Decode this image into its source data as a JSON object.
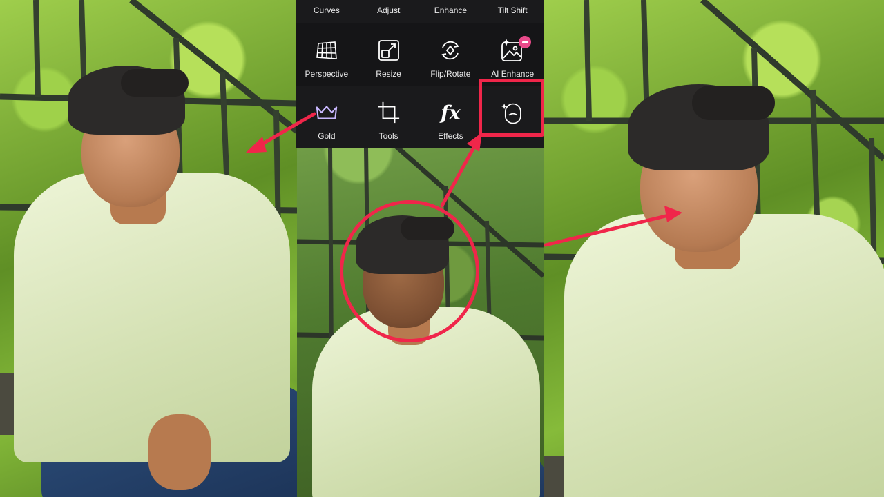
{
  "app": {
    "menu": {
      "row_top": [
        {
          "label": "Curves"
        },
        {
          "label": "Adjust"
        },
        {
          "label": "Enhance"
        },
        {
          "label": "Tilt Shift"
        }
      ],
      "row_mid": [
        {
          "label": "Perspective",
          "icon": "perspective-grid-icon"
        },
        {
          "label": "Resize",
          "icon": "resize-icon"
        },
        {
          "label": "Flip/Rotate",
          "icon": "flip-rotate-icon"
        },
        {
          "label": "AI Enhance",
          "icon": "ai-enhance-icon",
          "badge": "pro-badge"
        }
      ],
      "row_bottom": [
        {
          "label": "Gold",
          "icon": "crown-icon"
        },
        {
          "label": "Tools",
          "icon": "crop-icon"
        },
        {
          "label": "Effects",
          "icon": "fx-icon",
          "glyph": "fx"
        },
        {
          "label": "",
          "icon": "face-retouch-icon"
        }
      ]
    },
    "colors": {
      "accent": "#f0264a",
      "menu_bg": "#1a1a1c",
      "gold_icon": "#c9b8ff"
    }
  }
}
